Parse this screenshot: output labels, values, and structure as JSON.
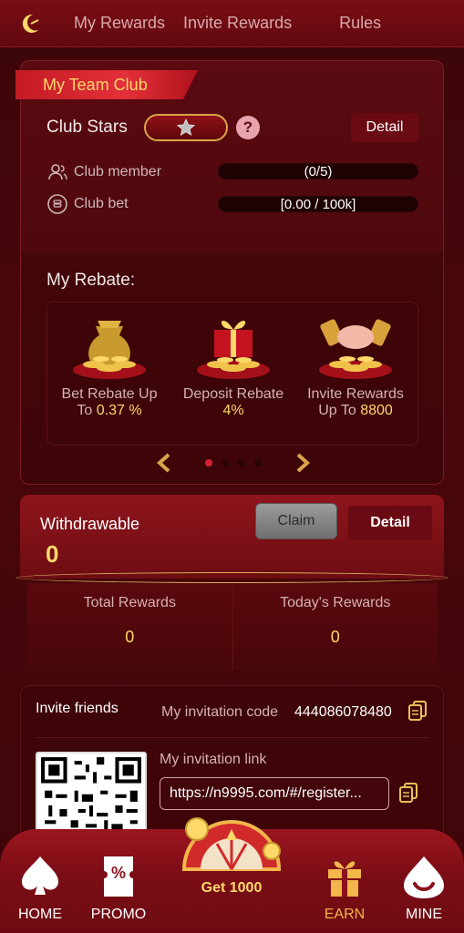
{
  "topnav": {
    "tabs": [
      "My Rewards",
      "Invite Rewards",
      "Rules"
    ]
  },
  "club": {
    "ribbon": "My Team Club",
    "stars_label": "Club Stars",
    "detail": "Detail",
    "member_label": "Club member",
    "member_value": "(0/5)",
    "bet_label": "Club bet",
    "bet_value": "[0.00 / 100k]"
  },
  "rebate": {
    "title": "My Rebate:",
    "items": [
      {
        "text": "Bet Rebate Up To",
        "value": "0.37 %"
      },
      {
        "text": "Deposit Rebate",
        "value": "4%"
      },
      {
        "text": "Invite Rewards Up To",
        "value": "8800"
      }
    ]
  },
  "withdraw": {
    "label": "Withdrawable",
    "value": "0",
    "claim": "Claim",
    "detail": "Detail"
  },
  "totals": {
    "total_label": "Total Rewards",
    "total_value": "0",
    "today_label": "Today's Rewards",
    "today_value": "0"
  },
  "invite": {
    "title": "Invite friends",
    "code_label": "My invitation code",
    "code_value": "444086078480",
    "link_label": "My invitation link",
    "link_value": "https://n9995.com/#/register..."
  },
  "bottomnav": {
    "home": "HOME",
    "promo": "PROMO",
    "get": "Get 1000",
    "earn": "EARN",
    "mine": "MINE"
  },
  "colors": {
    "accent_gold": "#ffd86a",
    "brand_red": "#7a0d14"
  }
}
